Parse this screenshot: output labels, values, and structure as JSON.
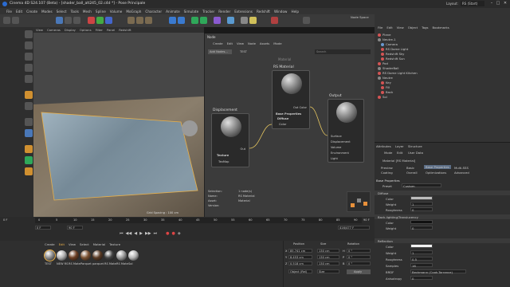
{
  "window": {
    "title": "Cinema 4D S24.107 (Beta) - [shader_ball_alt245_02.c4d *] - Pose Principale",
    "layout_label": "Layout:",
    "layout_value": "RS (Start)"
  },
  "menubar": [
    "File",
    "Edit",
    "Create",
    "Modes",
    "Select",
    "Tools",
    "Mesh",
    "Spline",
    "Volume",
    "MoGraph",
    "Character",
    "Animate",
    "Simulate",
    "Tracker",
    "Render",
    "Extensions",
    "Redshift",
    "Window",
    "Help"
  ],
  "node_space": {
    "label": "Node Space",
    "value": "Current (Redshift)"
  },
  "viewport": {
    "menu": [
      "View",
      "Cameras",
      "Display",
      "Options",
      "Filter",
      "Panel",
      "Redshift"
    ],
    "label": "Perspective",
    "grid_spacing": "Grid Spacing : 100 cm"
  },
  "node_editor": {
    "title": "Node",
    "menu": [
      "Create",
      "Edit",
      "View",
      "Node",
      "Assets",
      "Mode"
    ],
    "buttons": [
      "Add Nodes...",
      "TEST"
    ],
    "search_placeholder": "Search",
    "material_caption": "Material",
    "nodes": {
      "displacement": {
        "title": "Displacement",
        "out_port": "Out",
        "section": "Texture",
        "in_port": "TexMap"
      },
      "rs_material": {
        "title": "RS Material",
        "out_port": "Out Color",
        "section": "Base Properties",
        "subsection": "Diffuse",
        "in_port": "Color"
      },
      "output": {
        "title": "Output",
        "ports": [
          "Surface",
          "Displacement",
          "Volume",
          "Environment",
          "Light"
        ]
      }
    },
    "info": {
      "selection_label": "Selection:",
      "selection_value": "1 node(s)",
      "name_label": "Name:",
      "name_value": "RS Material",
      "asset_label": "Asset:",
      "asset_value": "Material",
      "version_label": "Version:",
      "version_value": ""
    }
  },
  "objects": {
    "menu": [
      "File",
      "Edit",
      "View",
      "Object",
      "Tags",
      "Bookmarks"
    ],
    "items": [
      "Plane",
      "Neutre.1",
      "Camera",
      "RS Dome Light",
      "Redshift Sky",
      "Redshift Sun",
      "Pod",
      "ShaderBall",
      "RS Dome Light Kitchen",
      "Neutre",
      "Key",
      "Fill",
      "Back",
      "Sol"
    ]
  },
  "attributes": {
    "tabs": [
      "Attributes",
      "Layer",
      "Structure"
    ],
    "menu": [
      "Mode",
      "Edit",
      "User Data"
    ],
    "object_title": "Material [RS Material]",
    "sub_tabs": [
      "Preview",
      "Basic",
      "Base Properties",
      "Multi-SSS",
      "Coating",
      "Overall",
      "Optimizations",
      "Advanced"
    ],
    "section_base": "Base Properties",
    "preset_label": "Preset",
    "preset_value": "Custom",
    "diffuse": {
      "title": "Diffuse",
      "rows": [
        {
          "label": "Color",
          "value": ""
        },
        {
          "label": "Weight",
          "value": "1"
        },
        {
          "label": "Roughness",
          "value": "0"
        }
      ]
    },
    "backlighting": {
      "title": "Back-lighting/Translucency",
      "rows": [
        {
          "label": "Color",
          "value": ""
        },
        {
          "label": "Weight",
          "value": "0"
        }
      ]
    },
    "reflection": {
      "title": "Reflection",
      "rows": [
        {
          "label": "Color",
          "value": ""
        },
        {
          "label": "Weight",
          "value": "1"
        },
        {
          "label": "Roughness",
          "value": "0.5"
        },
        {
          "label": "Samples",
          "value": "16"
        },
        {
          "label": "BRDF",
          "value": "Beckmann (Cook-Torrance)"
        },
        {
          "label": "Anisotropy",
          "value": "0"
        }
      ]
    }
  },
  "timeline": {
    "ticks": [
      "0",
      "5",
      "10",
      "15",
      "20",
      "25",
      "30",
      "35",
      "40",
      "45",
      "50",
      "55",
      "60",
      "65",
      "70",
      "75",
      "80",
      "85",
      "90"
    ],
    "current_frame": "0 F",
    "start": "0 F",
    "end": "90 F",
    "end_display": "90 F",
    "frame_display": "416/477 F"
  },
  "materials": {
    "menu": [
      "Create",
      "Edit",
      "View",
      "Select",
      "Material",
      "Texture"
    ],
    "items": [
      {
        "name": "TEST",
        "color": "#8a8a8a"
      },
      {
        "name": "NEW RS",
        "color": "#b0b0b0"
      },
      {
        "name": "RS Mate",
        "color": "#6a3d22"
      },
      {
        "name": "Parquet",
        "color": "#7a5030"
      },
      {
        "name": "parquet",
        "color": "#5a3a24"
      },
      {
        "name": "RS Mate",
        "color": "#444444"
      },
      {
        "name": "RS Mate",
        "color": "#9a9a9a"
      },
      {
        "name": "Sol",
        "color": "#b5b5b5"
      }
    ]
  },
  "coordinates": {
    "headers": [
      "Position",
      "Size",
      "Rotation"
    ],
    "rows": [
      {
        "axis": "X",
        "pos": "85.741 cm",
        "size": "130 cm",
        "rot_axis": "H",
        "rot": "0 °"
      },
      {
        "axis": "Y",
        "pos": "8.453 cm",
        "size": "130 cm",
        "rot_axis": "P",
        "rot": "0 °"
      },
      {
        "axis": "Z",
        "pos": "0.518 cm",
        "size": "130 cm",
        "rot_axis": "B",
        "rot": "0 °"
      }
    ],
    "mode_select": "Object (Rel)",
    "size_select": "Size",
    "apply": "Apply"
  },
  "colors": {
    "accent": "#e8b04a",
    "wire": "#e8c860",
    "panel": "#333333",
    "selected": "#5c6e86"
  }
}
